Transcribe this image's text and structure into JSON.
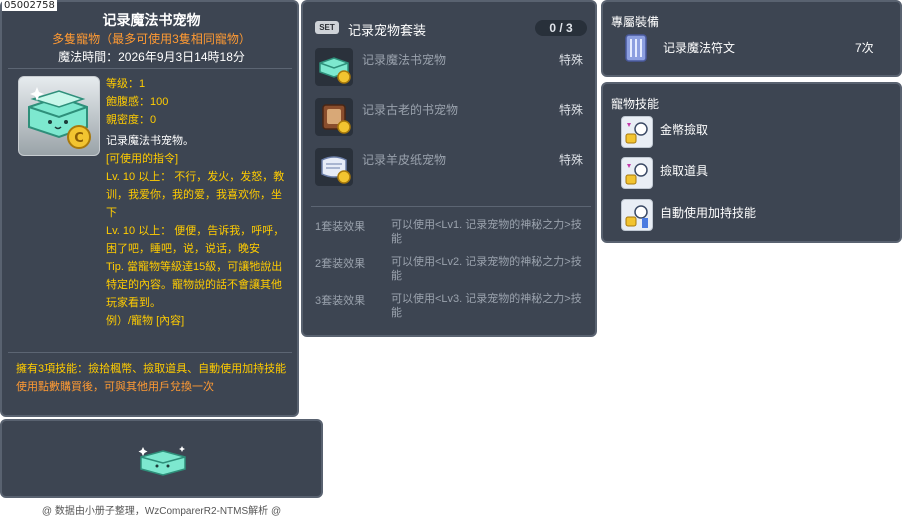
{
  "item_id": "05002758",
  "main": {
    "title": "记录魔法书宠物",
    "subtitle": "多隻寵物（最多可使用3隻相同寵物）",
    "magic_time": "魔法時間：2026年9月3日14時18分",
    "stats": {
      "level": "等级：1",
      "fullness": "飽腹感：100",
      "closeness": "親密度：0"
    },
    "desc_name": "记录魔法书宠物。",
    "desc_lines": [
      "[可使用的指令]",
      "Lv. 10 以上： 不行，发火，发怒，教训，我爱你，我的爱，我喜欢你，坐下",
      "Lv. 10 以上： 便便，告诉我，呼呼，困了吧，睡吧，说，说话，晚安",
      "Tip. 當寵物等級達15級，可讓牠說出特定的內容。寵物說的話不會讓其他玩家看到。",
      "例）/寵物 [內容]"
    ],
    "skills_text": "擁有3項技能：撿拾楓幣、撿取道具、自動使用加持技能",
    "trade_text": "使用點數購買後，可與其他用戶兌換一次"
  },
  "credit": "@ 数据由小册子整理，WzComparerR2-NTMS解析 @",
  "set": {
    "badge": "SET",
    "title": "记录宠物套装",
    "count": "0 / 3",
    "items": [
      {
        "name": "记录魔法书宠物",
        "type": "特殊"
      },
      {
        "name": "记录古老的书宠物",
        "type": "特殊"
      },
      {
        "name": "记录羊皮纸宠物",
        "type": "特殊"
      }
    ],
    "effects": [
      {
        "label": "1套装效果",
        "text": "可以使用<Lv1. 记录宠物的神秘之力>技能"
      },
      {
        "label": "2套装效果",
        "text": "可以使用<Lv2. 记录宠物的神秘之力>技能"
      },
      {
        "label": "3套装效果",
        "text": "可以使用<Lv3. 记录宠物的神秘之力>技能"
      }
    ]
  },
  "equip": {
    "header": "專屬裝備",
    "name": "记录魔法符文",
    "count": "7次"
  },
  "skills": {
    "header": "寵物技能",
    "items": [
      {
        "name": "金幣撿取"
      },
      {
        "name": "撿取道具"
      },
      {
        "name": "自動使用加持技能"
      }
    ]
  },
  "colors": {
    "panel_bg": "#3d4552",
    "accent_yellow": "#ffcc00",
    "accent_orange": "#ff9a33"
  }
}
